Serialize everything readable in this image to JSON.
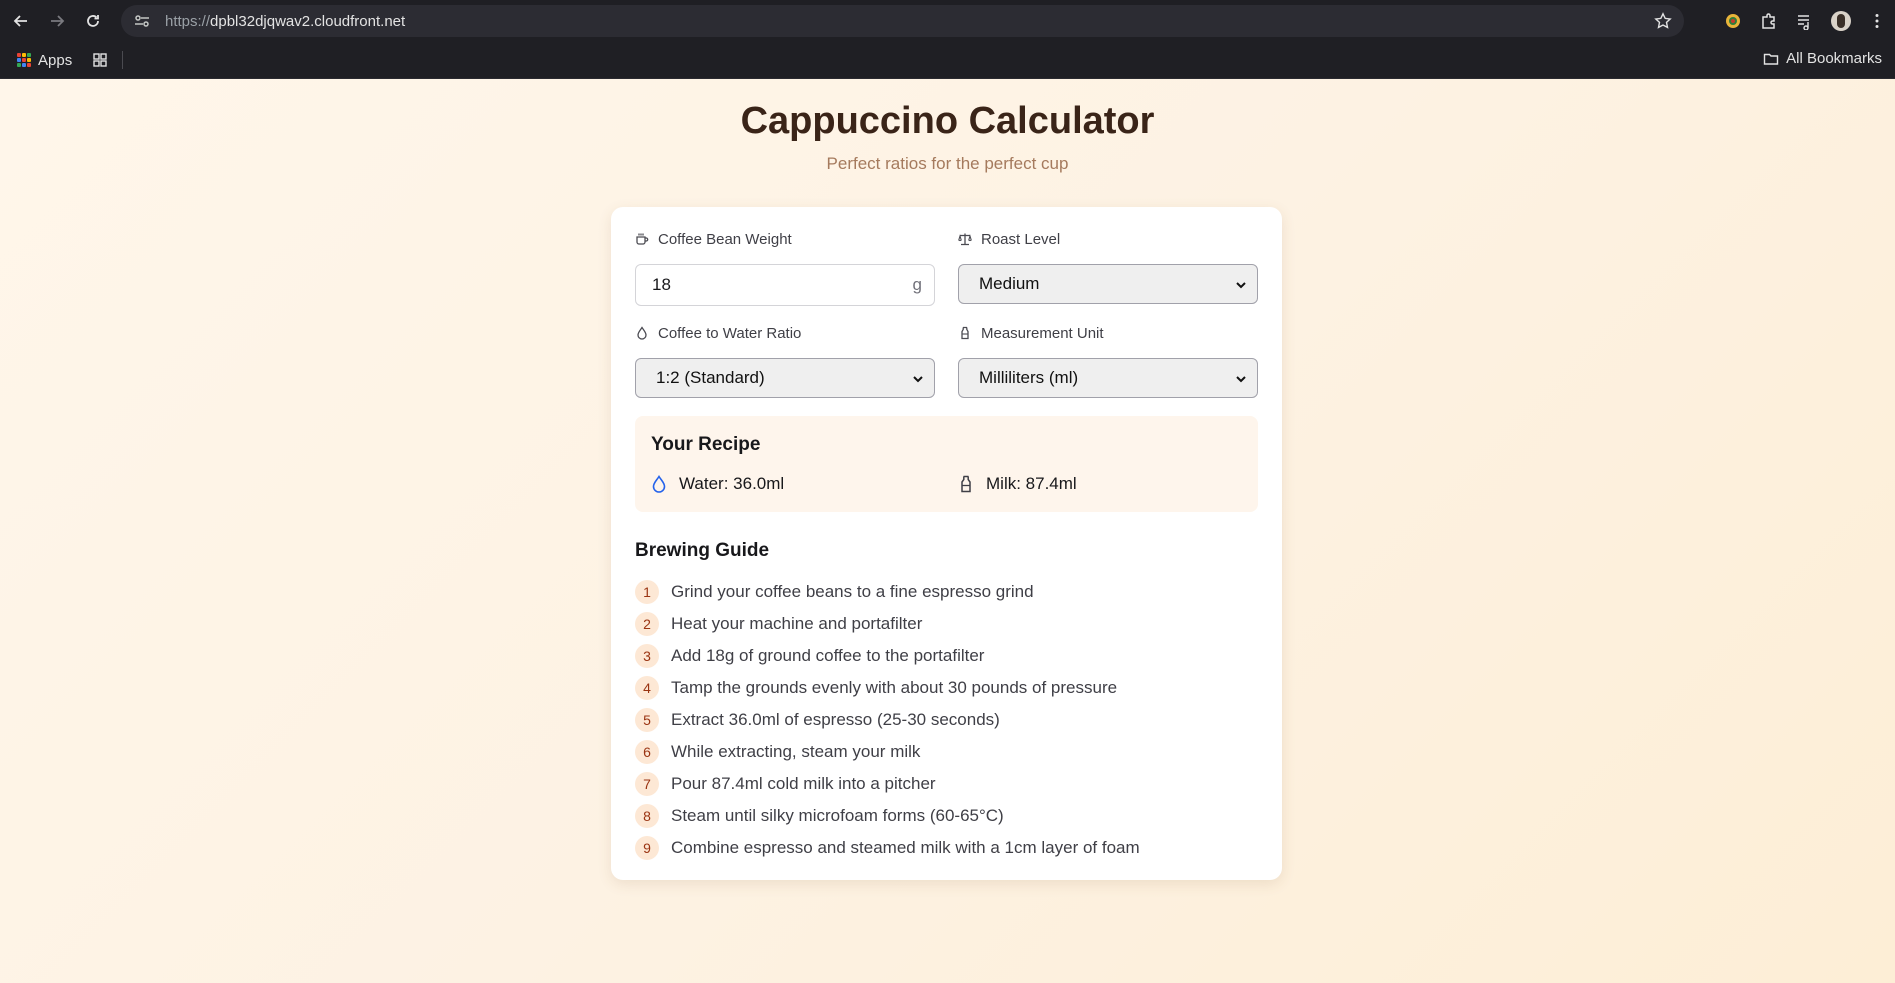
{
  "browser": {
    "url_protocol": "https://",
    "url_host": "dpbl32djqwav2.cloudfront.net",
    "bookmarks": {
      "apps_label": "Apps",
      "all_bookmarks_label": "All Bookmarks"
    }
  },
  "header": {
    "title": "Cappuccino Calculator",
    "subtitle": "Perfect ratios for the perfect cup"
  },
  "form": {
    "bean_weight": {
      "label": "Coffee Bean Weight",
      "value": "18",
      "unit": "g"
    },
    "roast_level": {
      "label": "Roast Level",
      "selected": "Medium"
    },
    "ratio": {
      "label": "Coffee to Water Ratio",
      "selected": "1:2 (Standard)"
    },
    "measurement_unit": {
      "label": "Measurement Unit",
      "selected": "Milliliters (ml)"
    }
  },
  "recipe": {
    "title": "Your Recipe",
    "water": "Water: 36.0ml",
    "milk": "Milk: 87.4ml"
  },
  "guide": {
    "title": "Brewing Guide",
    "steps": [
      {
        "num": "1",
        "text": "Grind your coffee beans to a fine espresso grind"
      },
      {
        "num": "2",
        "text": "Heat your machine and portafilter"
      },
      {
        "num": "3",
        "text": "Add 18g of ground coffee to the portafilter"
      },
      {
        "num": "4",
        "text": "Tamp the grounds evenly with about 30 pounds of pressure"
      },
      {
        "num": "5",
        "text": "Extract 36.0ml of espresso (25-30 seconds)"
      },
      {
        "num": "6",
        "text": "While extracting, steam your milk"
      },
      {
        "num": "7",
        "text": "Pour 87.4ml cold milk into a pitcher"
      },
      {
        "num": "8",
        "text": "Steam until silky microfoam forms (60-65°C)"
      },
      {
        "num": "9",
        "text": "Combine espresso and steamed milk with a 1cm layer of foam"
      }
    ]
  },
  "colors": {
    "title": "#3a2418",
    "subtitle": "#a57a5d",
    "step_badge_bg": "#fde8d5",
    "step_badge_text": "#9a3412",
    "water_icon": "#2563eb"
  }
}
